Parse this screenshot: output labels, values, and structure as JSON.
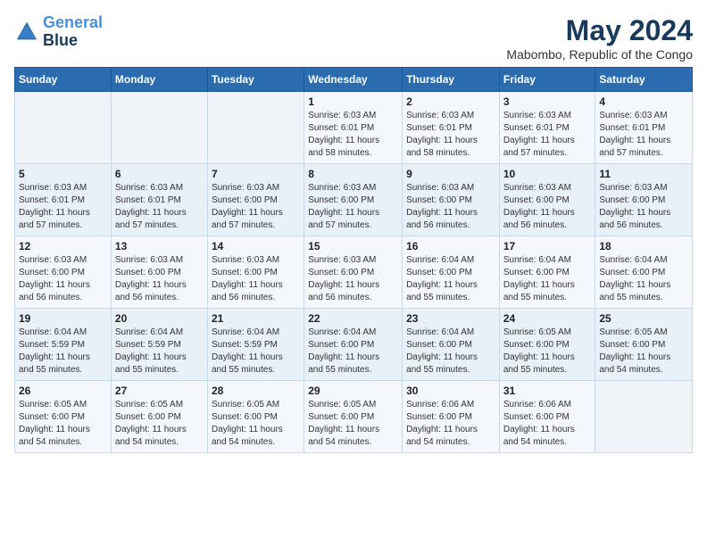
{
  "header": {
    "logo_line1": "General",
    "logo_line2": "Blue",
    "month_year": "May 2024",
    "location": "Mabombo, Republic of the Congo"
  },
  "weekdays": [
    "Sunday",
    "Monday",
    "Tuesday",
    "Wednesday",
    "Thursday",
    "Friday",
    "Saturday"
  ],
  "weeks": [
    [
      {
        "day": "",
        "info": ""
      },
      {
        "day": "",
        "info": ""
      },
      {
        "day": "",
        "info": ""
      },
      {
        "day": "1",
        "info": "Sunrise: 6:03 AM\nSunset: 6:01 PM\nDaylight: 11 hours\nand 58 minutes."
      },
      {
        "day": "2",
        "info": "Sunrise: 6:03 AM\nSunset: 6:01 PM\nDaylight: 11 hours\nand 58 minutes."
      },
      {
        "day": "3",
        "info": "Sunrise: 6:03 AM\nSunset: 6:01 PM\nDaylight: 11 hours\nand 57 minutes."
      },
      {
        "day": "4",
        "info": "Sunrise: 6:03 AM\nSunset: 6:01 PM\nDaylight: 11 hours\nand 57 minutes."
      }
    ],
    [
      {
        "day": "5",
        "info": "Sunrise: 6:03 AM\nSunset: 6:01 PM\nDaylight: 11 hours\nand 57 minutes."
      },
      {
        "day": "6",
        "info": "Sunrise: 6:03 AM\nSunset: 6:01 PM\nDaylight: 11 hours\nand 57 minutes."
      },
      {
        "day": "7",
        "info": "Sunrise: 6:03 AM\nSunset: 6:00 PM\nDaylight: 11 hours\nand 57 minutes."
      },
      {
        "day": "8",
        "info": "Sunrise: 6:03 AM\nSunset: 6:00 PM\nDaylight: 11 hours\nand 57 minutes."
      },
      {
        "day": "9",
        "info": "Sunrise: 6:03 AM\nSunset: 6:00 PM\nDaylight: 11 hours\nand 56 minutes."
      },
      {
        "day": "10",
        "info": "Sunrise: 6:03 AM\nSunset: 6:00 PM\nDaylight: 11 hours\nand 56 minutes."
      },
      {
        "day": "11",
        "info": "Sunrise: 6:03 AM\nSunset: 6:00 PM\nDaylight: 11 hours\nand 56 minutes."
      }
    ],
    [
      {
        "day": "12",
        "info": "Sunrise: 6:03 AM\nSunset: 6:00 PM\nDaylight: 11 hours\nand 56 minutes."
      },
      {
        "day": "13",
        "info": "Sunrise: 6:03 AM\nSunset: 6:00 PM\nDaylight: 11 hours\nand 56 minutes."
      },
      {
        "day": "14",
        "info": "Sunrise: 6:03 AM\nSunset: 6:00 PM\nDaylight: 11 hours\nand 56 minutes."
      },
      {
        "day": "15",
        "info": "Sunrise: 6:03 AM\nSunset: 6:00 PM\nDaylight: 11 hours\nand 56 minutes."
      },
      {
        "day": "16",
        "info": "Sunrise: 6:04 AM\nSunset: 6:00 PM\nDaylight: 11 hours\nand 55 minutes."
      },
      {
        "day": "17",
        "info": "Sunrise: 6:04 AM\nSunset: 6:00 PM\nDaylight: 11 hours\nand 55 minutes."
      },
      {
        "day": "18",
        "info": "Sunrise: 6:04 AM\nSunset: 6:00 PM\nDaylight: 11 hours\nand 55 minutes."
      }
    ],
    [
      {
        "day": "19",
        "info": "Sunrise: 6:04 AM\nSunset: 5:59 PM\nDaylight: 11 hours\nand 55 minutes."
      },
      {
        "day": "20",
        "info": "Sunrise: 6:04 AM\nSunset: 5:59 PM\nDaylight: 11 hours\nand 55 minutes."
      },
      {
        "day": "21",
        "info": "Sunrise: 6:04 AM\nSunset: 5:59 PM\nDaylight: 11 hours\nand 55 minutes."
      },
      {
        "day": "22",
        "info": "Sunrise: 6:04 AM\nSunset: 6:00 PM\nDaylight: 11 hours\nand 55 minutes."
      },
      {
        "day": "23",
        "info": "Sunrise: 6:04 AM\nSunset: 6:00 PM\nDaylight: 11 hours\nand 55 minutes."
      },
      {
        "day": "24",
        "info": "Sunrise: 6:05 AM\nSunset: 6:00 PM\nDaylight: 11 hours\nand 55 minutes."
      },
      {
        "day": "25",
        "info": "Sunrise: 6:05 AM\nSunset: 6:00 PM\nDaylight: 11 hours\nand 54 minutes."
      }
    ],
    [
      {
        "day": "26",
        "info": "Sunrise: 6:05 AM\nSunset: 6:00 PM\nDaylight: 11 hours\nand 54 minutes."
      },
      {
        "day": "27",
        "info": "Sunrise: 6:05 AM\nSunset: 6:00 PM\nDaylight: 11 hours\nand 54 minutes."
      },
      {
        "day": "28",
        "info": "Sunrise: 6:05 AM\nSunset: 6:00 PM\nDaylight: 11 hours\nand 54 minutes."
      },
      {
        "day": "29",
        "info": "Sunrise: 6:05 AM\nSunset: 6:00 PM\nDaylight: 11 hours\nand 54 minutes."
      },
      {
        "day": "30",
        "info": "Sunrise: 6:06 AM\nSunset: 6:00 PM\nDaylight: 11 hours\nand 54 minutes."
      },
      {
        "day": "31",
        "info": "Sunrise: 6:06 AM\nSunset: 6:00 PM\nDaylight: 11 hours\nand 54 minutes."
      },
      {
        "day": "",
        "info": ""
      }
    ]
  ]
}
